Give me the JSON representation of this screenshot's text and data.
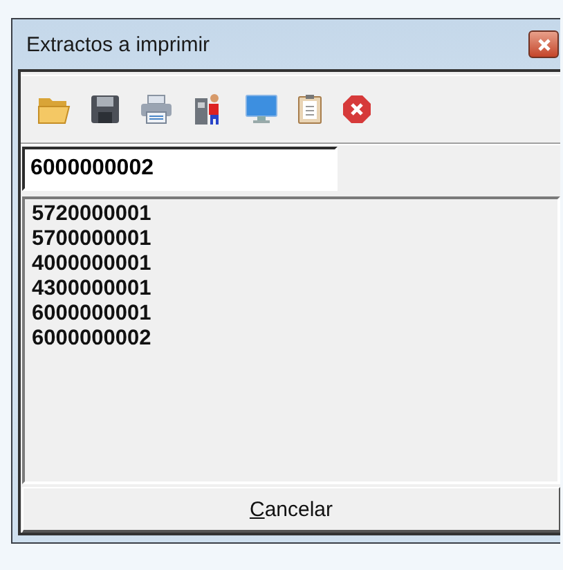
{
  "window": {
    "title": "Extractos a imprimir"
  },
  "toolbar": [
    {
      "kind": "folder"
    },
    {
      "kind": "floppy"
    },
    {
      "kind": "printer"
    },
    {
      "kind": "person"
    },
    {
      "kind": "monitor"
    },
    {
      "kind": "clipboard"
    },
    {
      "kind": "stop"
    }
  ],
  "field": {
    "value": "6000000002"
  },
  "list": [
    "5720000001",
    "5700000001",
    "4000000001",
    "4300000001",
    "6000000001",
    "6000000002"
  ],
  "button": {
    "label": "Cancelar"
  }
}
